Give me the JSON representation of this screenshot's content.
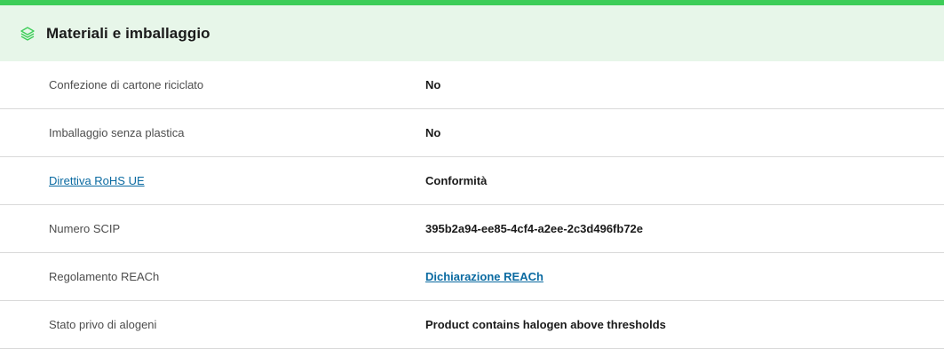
{
  "section": {
    "title": "Materiali e imballaggio",
    "icon": "layers-icon",
    "accent_color": "#3dcd58",
    "header_bg": "#e7f6e9"
  },
  "rows": [
    {
      "label": "Confezione di cartone riciclato",
      "value": "No"
    },
    {
      "label": "Imballaggio senza plastica",
      "value": "No"
    },
    {
      "label": "Direttiva RoHS UE",
      "value": "Conformità",
      "label_is_link": true
    },
    {
      "label": "Numero SCIP",
      "value": "395b2a94-ee85-4cf4-a2ee-2c3d496fb72e"
    },
    {
      "label": "Regolamento REACh",
      "value": "Dichiarazione REACh",
      "value_is_link": true
    },
    {
      "label": "Stato privo di alogeni",
      "value": "Product contains halogen above thresholds"
    }
  ]
}
